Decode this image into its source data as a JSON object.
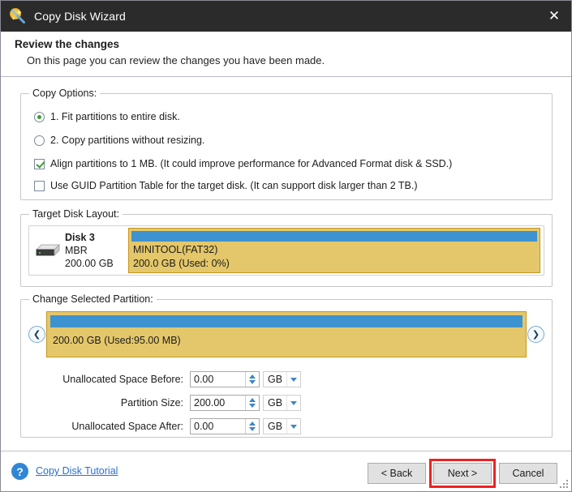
{
  "window": {
    "title": "Copy Disk Wizard",
    "icon": "wizard-wand-icon",
    "close_label": "✕"
  },
  "header": {
    "title": "Review the changes",
    "subtitle": "On this page you can review the changes you have been made."
  },
  "copy_options": {
    "legend": "Copy Options:",
    "items": [
      {
        "type": "radio",
        "checked": true,
        "label": "1. Fit partitions to entire disk."
      },
      {
        "type": "radio",
        "checked": false,
        "label": "2. Copy partitions without resizing."
      },
      {
        "type": "checkbox",
        "checked": true,
        "label": "Align partitions to 1 MB.  (It could improve performance for Advanced Format disk & SSD.)"
      },
      {
        "type": "checkbox",
        "checked": false,
        "label": "Use GUID Partition Table for the target disk. (It can support disk larger than 2 TB.)"
      }
    ]
  },
  "target_disk_layout": {
    "legend": "Target Disk Layout:",
    "disk": {
      "icon": "hard-disk-icon",
      "name": "Disk 3",
      "scheme": "MBR",
      "capacity": "200.00 GB"
    },
    "partition": {
      "label": "MINITOOL(FAT32)",
      "detail": "200.0 GB (Used: 0%)",
      "used_percent": 0,
      "fill_color": "#e4c76a",
      "border_color": "#c8961e",
      "bar_color": "#3d92d0"
    }
  },
  "change_selected_partition": {
    "legend": "Change Selected Partition:",
    "prev_arrow": "❮",
    "next_arrow": "❯",
    "selected": {
      "label": "200.00 GB (Used:95.00 MB)",
      "fill_color": "#e4c76a",
      "border_color": "#c8961e",
      "bar_color": "#3d92d0"
    },
    "fields": [
      {
        "label": "Unallocated Space Before:",
        "value": "0.00",
        "unit": "GB"
      },
      {
        "label": "Partition Size:",
        "value": "200.00",
        "unit": "GB"
      },
      {
        "label": "Unallocated Space After:",
        "value": "0.00",
        "unit": "GB"
      }
    ]
  },
  "footer": {
    "help_icon": "question-mark-icon",
    "help_glyph": "?",
    "tutorial_link": "Copy Disk Tutorial",
    "buttons": {
      "back": "< Back",
      "next": "Next >",
      "cancel": "Cancel"
    },
    "highlight_color": "#ee2222"
  }
}
